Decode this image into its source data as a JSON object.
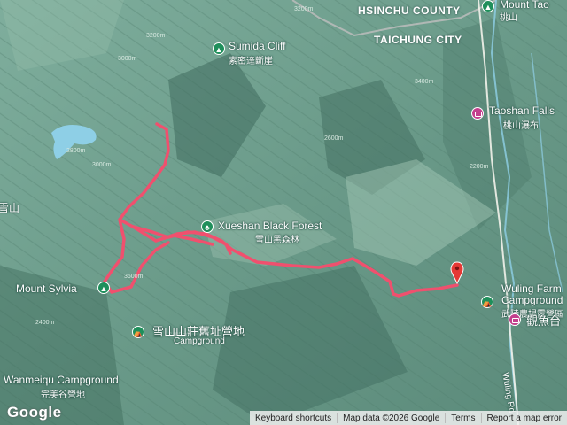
{
  "places": {
    "sumida_cliff": {
      "en": "Sumida Cliff",
      "zh": "素密達斷崖"
    },
    "xueshan_black_forest": {
      "en": "Xueshan Black Forest",
      "zh": "雪山黑森林"
    },
    "mount_sylvia": {
      "en": "Mount Sylvia"
    },
    "xueshan_lodge_campground": {
      "zh": "雪山山莊舊址營地",
      "en": "Campground"
    },
    "wanmeiqu_campground": {
      "en": "Wanmeiqu Campground",
      "zh": "完美谷營地"
    },
    "wuling_farm_campground": {
      "en": "Wuling Farm Campground",
      "zh": "武陵農場露營區"
    },
    "taoshan_falls": {
      "en": "Taoshan Falls",
      "zh": "桃山瀑布"
    },
    "fish_viewing": {
      "zh": "觀魚台"
    },
    "top_right_partial": {
      "en": "Mount Tao",
      "zh": "桃山"
    },
    "left_partial": {
      "zh": "雪山"
    }
  },
  "regions": {
    "hsinchu": "HSINCHU COUNTY",
    "taichung": "TAICHUNG CITY"
  },
  "roads": {
    "wuling_road": "Wuling Rd"
  },
  "contour_labels": [
    "3200m",
    "3000m",
    "2800m",
    "2600m",
    "3400m",
    "3600m",
    "2400m",
    "2200m"
  ],
  "branding": {
    "logo": "Google"
  },
  "attribution": {
    "keyboard": "Keyboard shortcuts",
    "data": "Map data ©2026 Google",
    "terms": "Terms",
    "report": "Report a map error"
  },
  "colors": {
    "track": "#f0506e",
    "terrain": "#6f9e8e",
    "water": "#8ecfe6",
    "poi_green": "#1f8f5b",
    "poi_pink": "#c33f8d",
    "marker": "#e53935"
  }
}
